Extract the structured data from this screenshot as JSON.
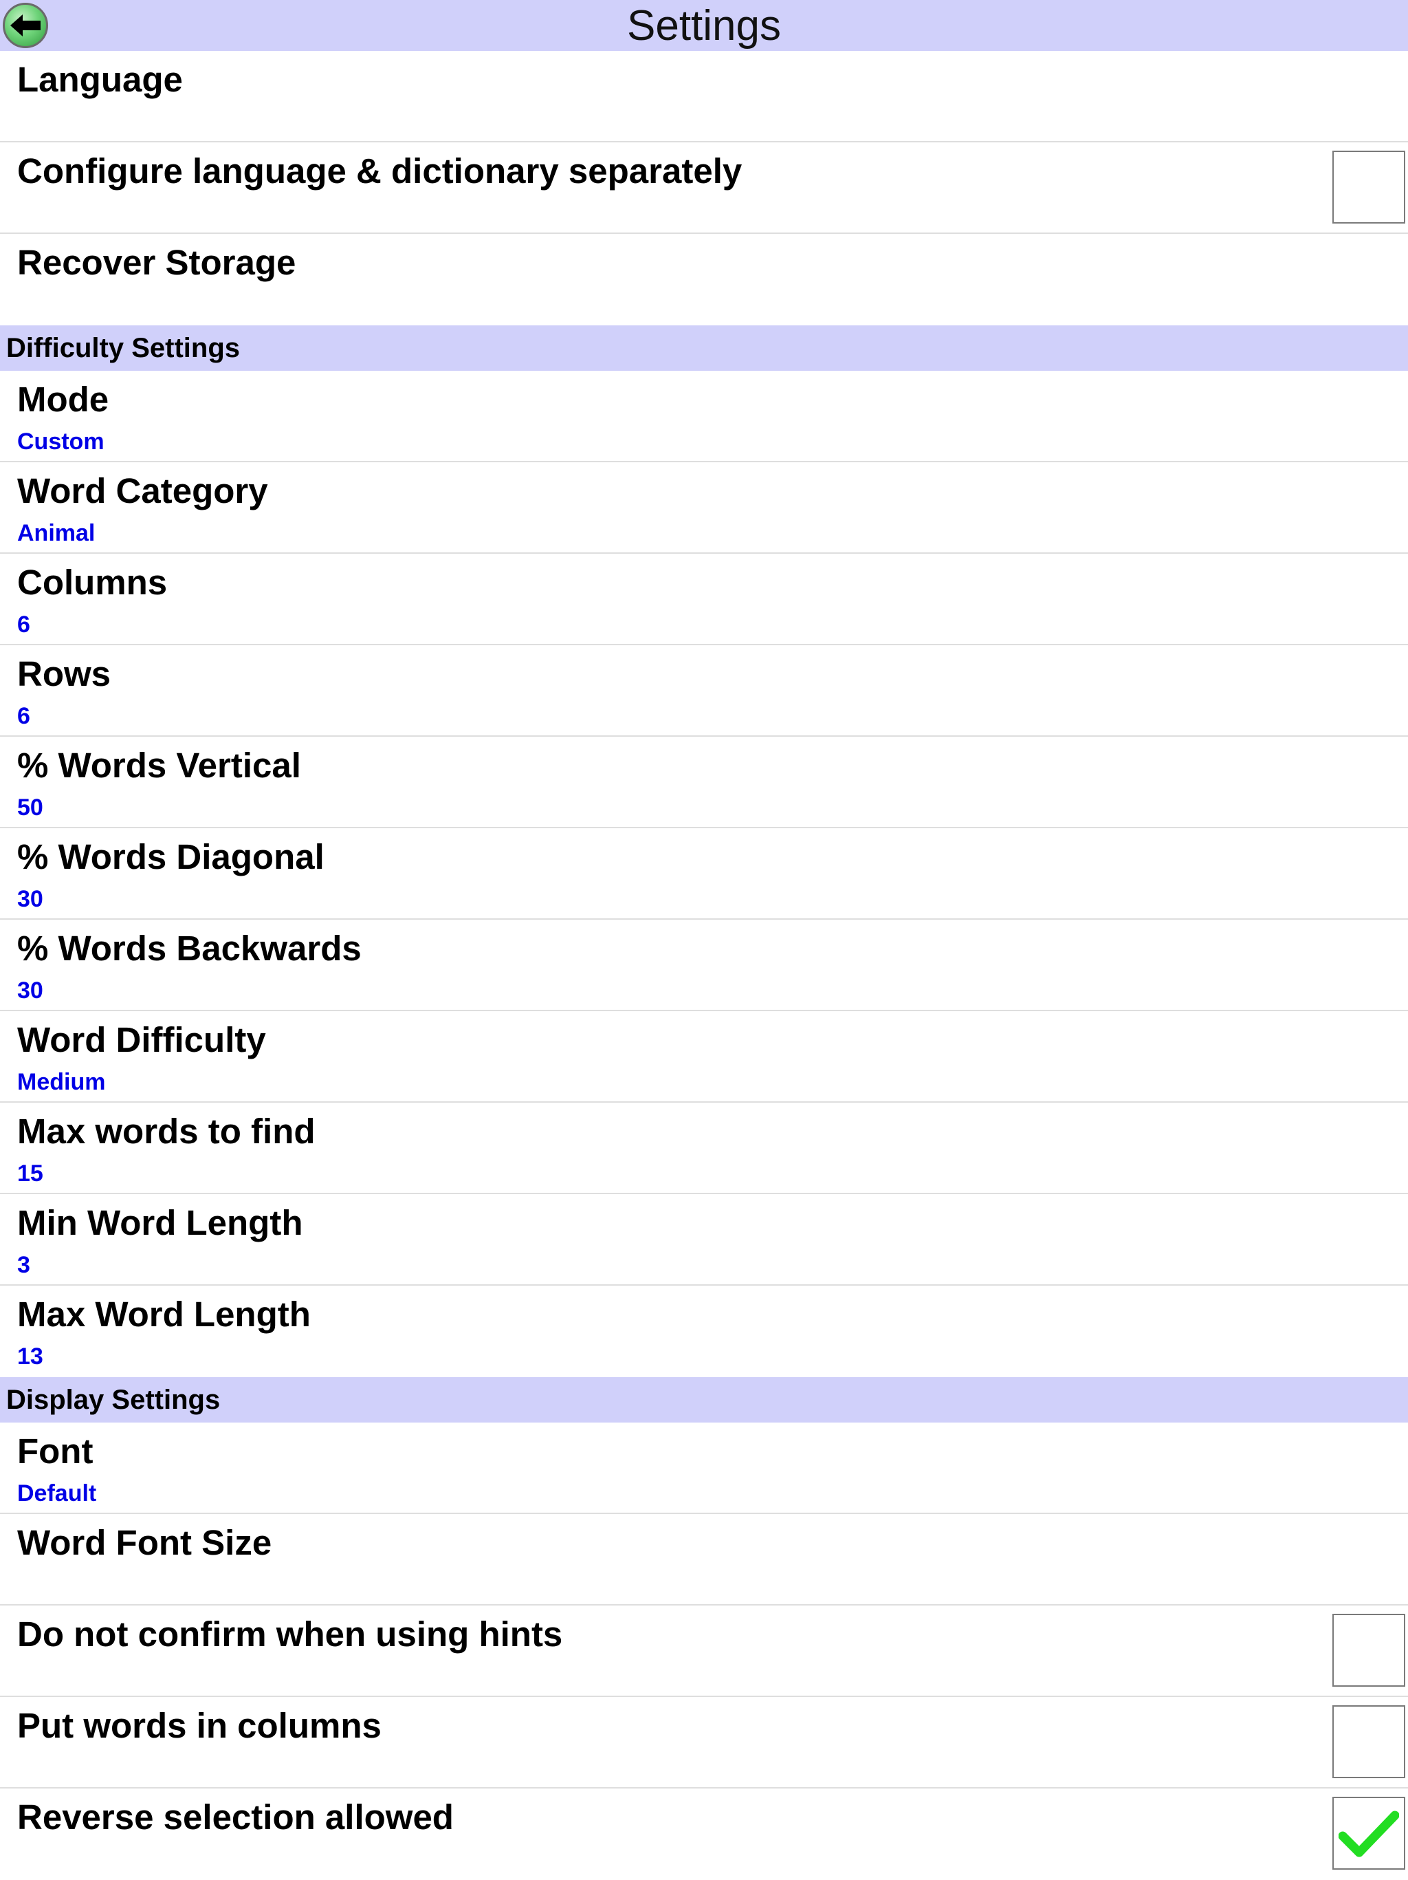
{
  "header": {
    "title": "Settings"
  },
  "colors": {
    "header_bg": "#d0d0fa",
    "value_text": "#0000e6",
    "check_mark": "#22dd22"
  },
  "general": [
    {
      "label": "Language",
      "value": ""
    },
    {
      "label": "Configure language & dictionary separately",
      "checkbox": true,
      "checked": false
    },
    {
      "label": "Recover Storage",
      "value": ""
    }
  ],
  "difficulty": {
    "header": "Difficulty Settings",
    "items": [
      {
        "label": "Mode",
        "value": "Custom"
      },
      {
        "label": "Word Category",
        "value": "Animal"
      },
      {
        "label": "Columns",
        "value": "6"
      },
      {
        "label": "Rows",
        "value": "6"
      },
      {
        "label": "% Words Vertical",
        "value": "50"
      },
      {
        "label": "% Words Diagonal",
        "value": "30"
      },
      {
        "label": "% Words Backwards",
        "value": "30"
      },
      {
        "label": "Word Difficulty",
        "value": "Medium"
      },
      {
        "label": "Max words to find",
        "value": "15"
      },
      {
        "label": "Min Word Length",
        "value": "3"
      },
      {
        "label": "Max Word Length",
        "value": "13"
      }
    ]
  },
  "display": {
    "header": "Display Settings",
    "items": [
      {
        "label": "Font",
        "value": "Default"
      },
      {
        "label": "Word Font Size",
        "value": ""
      },
      {
        "label": "Do not confirm when using hints",
        "checkbox": true,
        "checked": false
      },
      {
        "label": "Put words in columns",
        "checkbox": true,
        "checked": false
      },
      {
        "label": "Reverse selection allowed",
        "checkbox": true,
        "checked": true
      }
    ]
  }
}
